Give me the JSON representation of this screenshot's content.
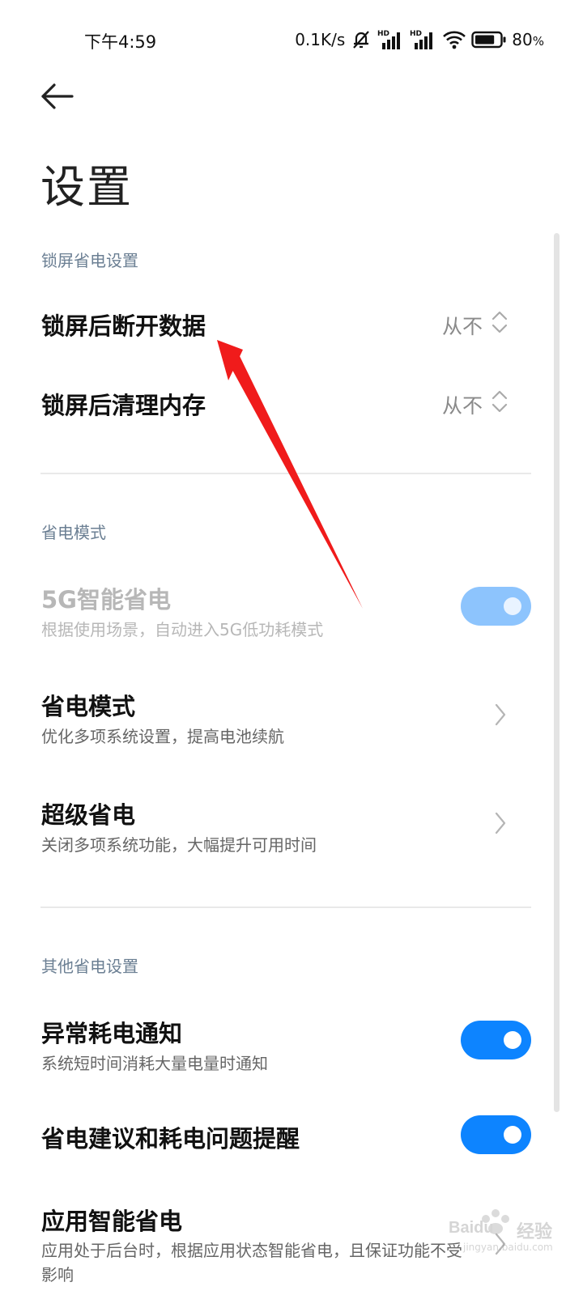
{
  "status_bar": {
    "time": "下午4:59",
    "net_speed": "0.1K/s",
    "battery_percent": "80",
    "battery_unit": "%",
    "battery_level": 0.8,
    "sim1_badge": "HD",
    "sim2_badge": "HD"
  },
  "header": {
    "title": "设置"
  },
  "sections": {
    "lock": {
      "label": "锁屏省电设置",
      "disconnect_data": {
        "title": "锁屏后断开数据",
        "value": "从不"
      },
      "clear_memory": {
        "title": "锁屏后清理内存",
        "value": "从不"
      }
    },
    "mode": {
      "label": "省电模式",
      "smart_5g": {
        "title": "5G智能省电",
        "subtitle": "根据使用场景，自动进入5G低功耗模式",
        "enabled": true,
        "disabled": true
      },
      "power_save": {
        "title": "省电模式",
        "subtitle": "优化多项系统设置，提高电池续航"
      },
      "ultra_save": {
        "title": "超级省电",
        "subtitle": "关闭多项系统功能，大幅提升可用时间"
      }
    },
    "other": {
      "label": "其他省电设置",
      "abnormal_notify": {
        "title": "异常耗电通知",
        "subtitle": "系统短时间消耗大量电量时通知",
        "enabled": true
      },
      "suggestions": {
        "title": "省电建议和耗电问题提醒",
        "enabled": true
      },
      "app_smart": {
        "title": "应用智能省电",
        "subtitle": "应用处于后台时，根据应用状态智能省电，且保证功能不受影响"
      }
    }
  },
  "colors": {
    "accent": "#0d84ff",
    "arrow": "#f01b1b",
    "section_label": "#6b7f93"
  },
  "watermark": {
    "brand": "Baidu",
    "brand_suffix": "经验",
    "url": "jingyan.baidu.com"
  }
}
